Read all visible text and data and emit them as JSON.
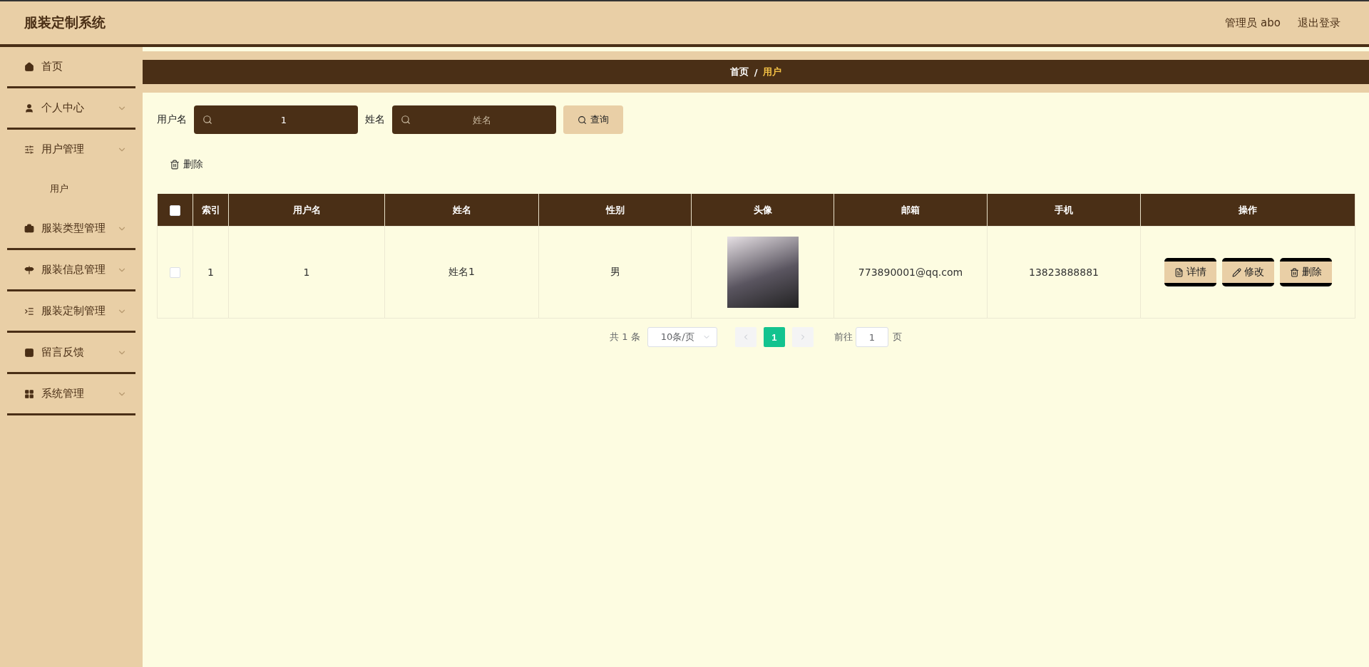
{
  "header": {
    "title": "服装定制系统",
    "user": "管理员 abo",
    "logout": "退出登录"
  },
  "sidebar": {
    "items": [
      {
        "label": "首页",
        "kind": "link"
      },
      {
        "label": "个人中心",
        "kind": "menu"
      },
      {
        "label": "用户管理",
        "kind": "menu",
        "expanded": true,
        "children": [
          {
            "label": "用户"
          }
        ]
      },
      {
        "label": "服装类型管理",
        "kind": "menu"
      },
      {
        "label": "服装信息管理",
        "kind": "menu"
      },
      {
        "label": "服装定制管理",
        "kind": "menu"
      },
      {
        "label": "留言反馈",
        "kind": "menu"
      },
      {
        "label": "系统管理",
        "kind": "menu"
      }
    ]
  },
  "breadcrumb": {
    "home": "首页",
    "separator": "/",
    "current": "用户"
  },
  "search": {
    "fields": [
      {
        "label": "用户名",
        "value": "1"
      },
      {
        "label": "姓名",
        "placeholder": "姓名"
      }
    ],
    "button": "查询"
  },
  "toolbar": {
    "delete": "删除"
  },
  "table": {
    "header_checked": false,
    "columns": [
      "索引",
      "用户名",
      "姓名",
      "性别",
      "头像",
      "邮箱",
      "手机",
      "操作"
    ],
    "rows": [
      {
        "checked": false,
        "index": "1",
        "username": "1",
        "name": "姓名1",
        "gender": "男",
        "email": "773890001@qq.com",
        "phone": "13823888881",
        "actions": [
          {
            "kind": "detail",
            "label": "详情"
          },
          {
            "kind": "edit",
            "label": "修改"
          },
          {
            "kind": "delete",
            "label": "删除"
          }
        ]
      }
    ]
  },
  "pagination": {
    "total": "共 1 条",
    "page_size": "10条/页",
    "pages": [
      {
        "label": "1",
        "selected": true
      }
    ],
    "goto_label": "前往",
    "goto_value": "1",
    "page_unit": "页"
  }
}
